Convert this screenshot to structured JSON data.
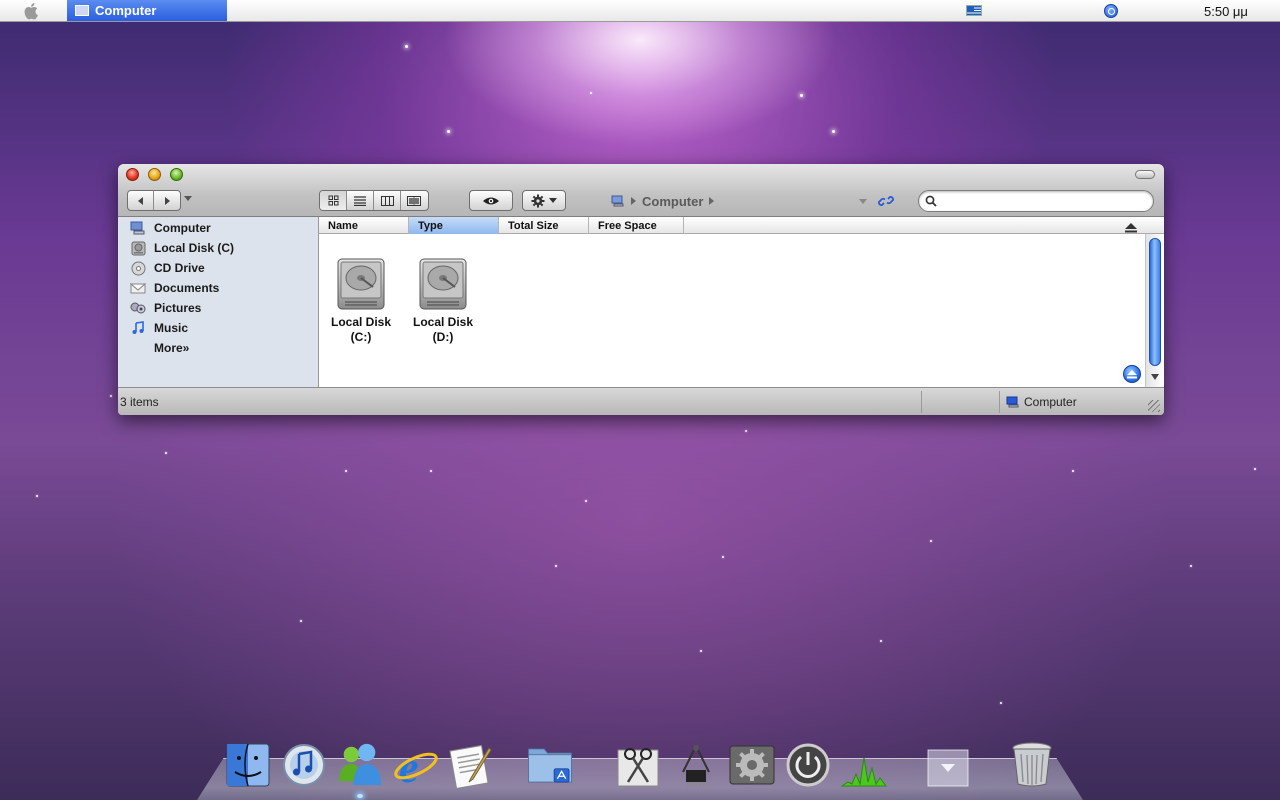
{
  "menubar": {
    "active_app": "Computer",
    "clock": "5:50 μμ"
  },
  "window": {
    "path": {
      "current": "Computer"
    },
    "search": {
      "value": "",
      "placeholder": ""
    },
    "sidebar": {
      "items": [
        {
          "label": "Computer",
          "icon": "computer-icon"
        },
        {
          "label": "Local Disk (C)",
          "icon": "hard-drive-icon"
        },
        {
          "label": "CD Drive",
          "icon": "cd-icon"
        },
        {
          "label": "Documents",
          "icon": "documents-icon"
        },
        {
          "label": "Pictures",
          "icon": "pictures-icon"
        },
        {
          "label": "Music",
          "icon": "music-note-icon"
        }
      ],
      "more_label": "More»"
    },
    "columns": [
      {
        "label": "Name",
        "sorted": false
      },
      {
        "label": "Type",
        "sorted": true
      },
      {
        "label": "Total Size",
        "sorted": false
      },
      {
        "label": "Free Space",
        "sorted": false
      }
    ],
    "files": [
      {
        "line1": "Local Disk",
        "line2": "(C:)",
        "icon": "hard-drive-icon"
      },
      {
        "line1": "Local Disk",
        "line2": "(D:)",
        "icon": "hard-drive-icon"
      }
    ],
    "status": {
      "items_count": "3 items",
      "location": "Computer"
    }
  },
  "dock": {
    "items": [
      {
        "name": "finder",
        "icon": "finder-icon"
      },
      {
        "name": "itunes",
        "icon": "itunes-icon"
      },
      {
        "name": "messenger",
        "icon": "messenger-icon"
      },
      {
        "name": "internet-explorer",
        "icon": "internet-explorer-icon"
      },
      {
        "name": "textedit",
        "icon": "textedit-icon"
      },
      {
        "name": "applications-folder",
        "icon": "folder-icon"
      },
      {
        "name": "snipping-tool",
        "icon": "scissors-icon"
      },
      {
        "name": "system-utility",
        "icon": "chip-icon"
      },
      {
        "name": "system-preferences",
        "icon": "gear-icon"
      },
      {
        "name": "shutdown",
        "icon": "power-icon"
      },
      {
        "name": "activity-monitor",
        "icon": "activity-graph-icon"
      },
      {
        "name": "stack",
        "icon": "stack-icon"
      },
      {
        "name": "trash",
        "icon": "trash-icon"
      }
    ]
  },
  "colors": {
    "accent": "#2a5ee0",
    "sidebar_bg": "#dde3ec"
  }
}
